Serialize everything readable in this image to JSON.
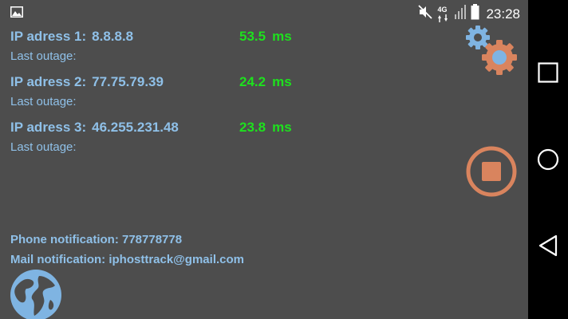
{
  "status_bar": {
    "time": "23:28",
    "network_label": "4G",
    "icons": [
      "image-icon",
      "mute-icon",
      "network-4g-icon",
      "signal-icon",
      "battery-icon"
    ]
  },
  "hosts": [
    {
      "label": "IP adress 1:",
      "address": "8.8.8.8",
      "latency": "53.5",
      "unit": "ms",
      "outage_label": "Last outage:"
    },
    {
      "label": "IP adress 2:",
      "address": "77.75.79.39",
      "latency": "24.2",
      "unit": "ms",
      "outage_label": "Last outage:"
    },
    {
      "label": "IP adress 3:",
      "address": "46.255.231.48",
      "latency": "23.8",
      "unit": "ms",
      "outage_label": "Last outage:"
    }
  ],
  "notifications": {
    "phone": "Phone notification: 778778778",
    "mail": "Mail notification: iphosttrack@gmail.com"
  },
  "colors": {
    "background": "#4d4d4d",
    "label_text": "#8fc0e8",
    "latency_text": "#1ee01e",
    "accent_orange": "#d9845e",
    "gear_blue": "#7fb4e2",
    "navbar": "#000000"
  },
  "controls": {
    "settings_icon": "gears-icon",
    "stop_icon": "stop-icon",
    "globe_icon": "globe-icon"
  },
  "nav_bar": {
    "icons": [
      "recents-square-icon",
      "home-circle-icon",
      "back-triangle-icon"
    ]
  }
}
